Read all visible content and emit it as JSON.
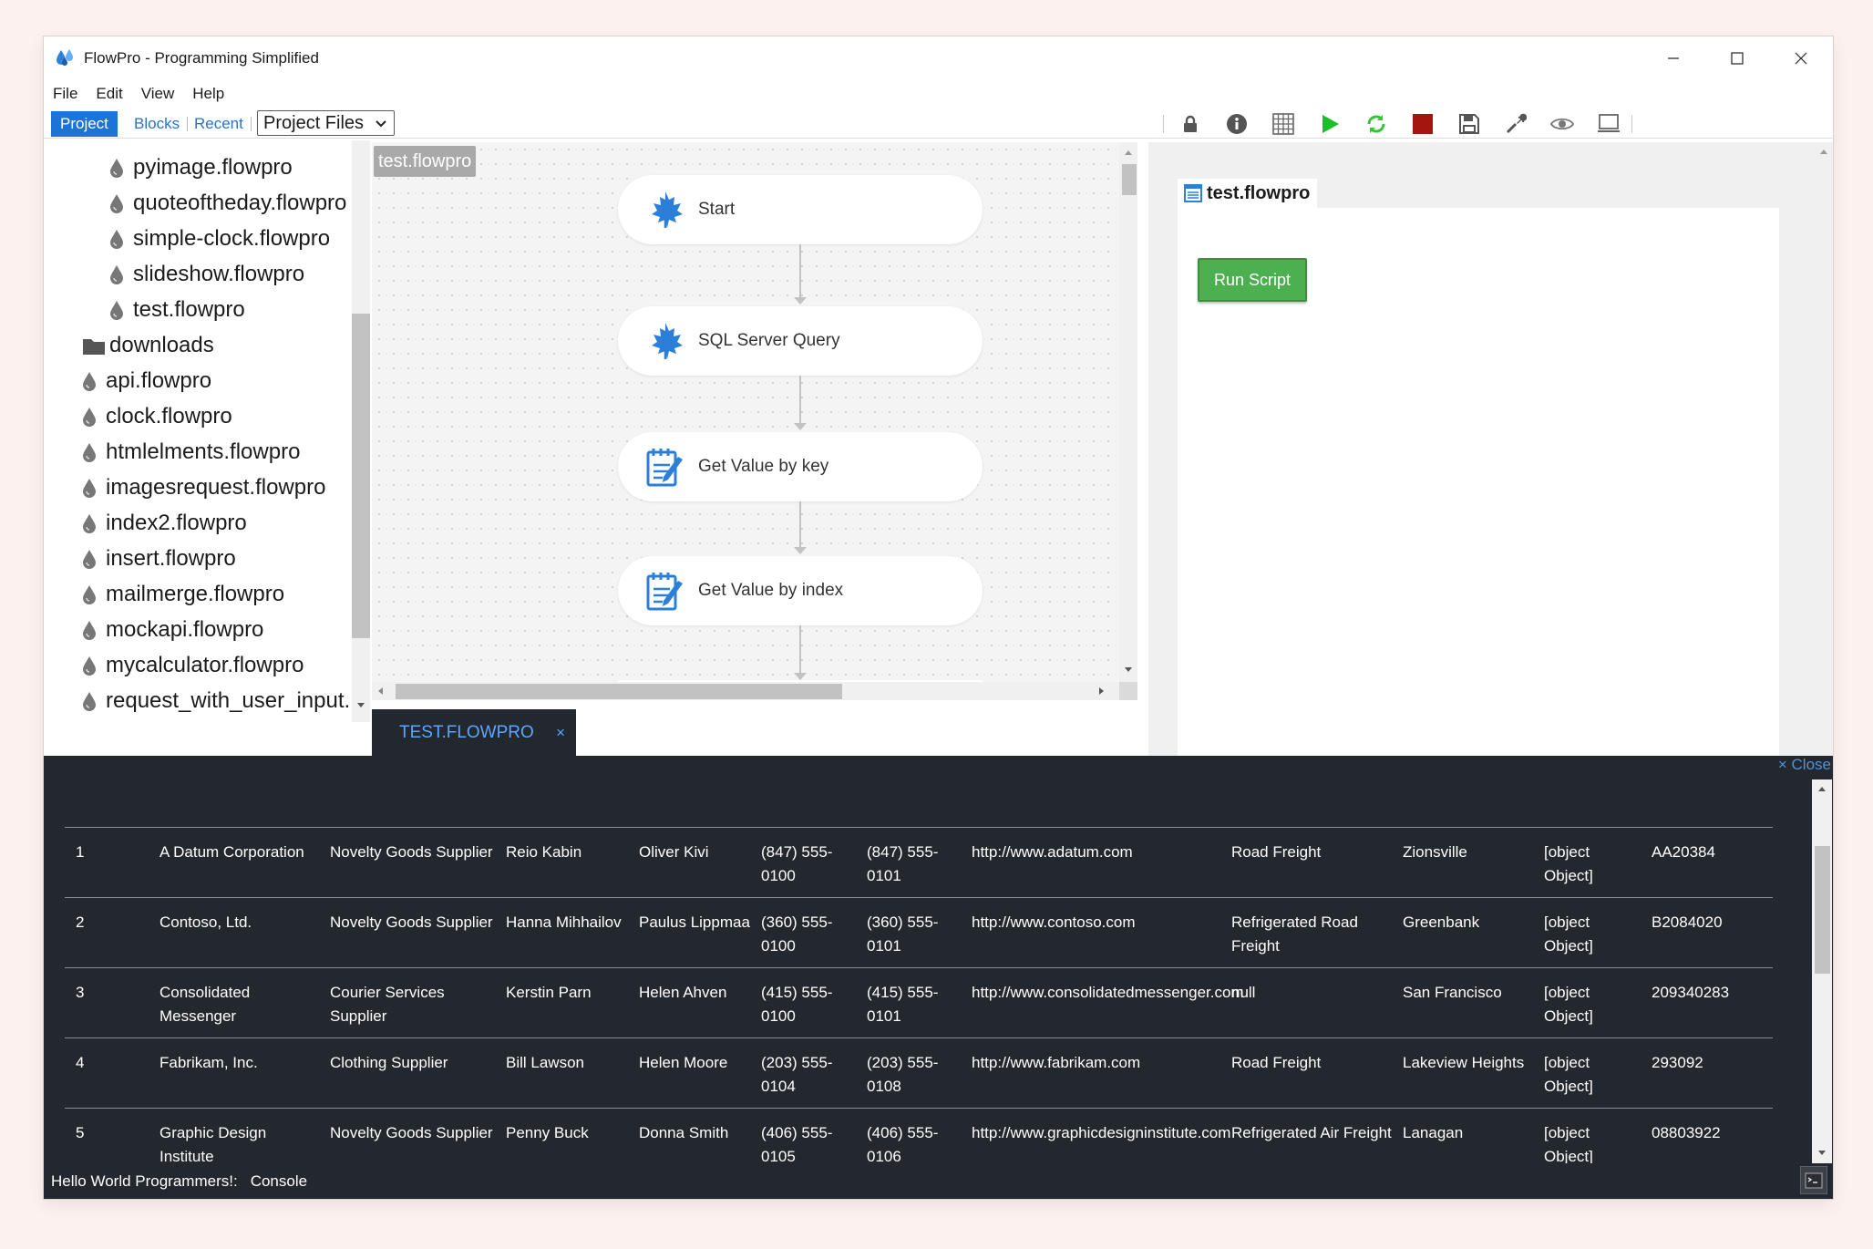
{
  "window": {
    "title": "FlowPro - Programming Simplified"
  },
  "menu": [
    "File",
    "Edit",
    "View",
    "Help"
  ],
  "toolbar": {
    "tab_project": "Project",
    "tab_blocks": "Blocks",
    "tab_recent": "Recent",
    "project_select": "Project Files",
    "tools": [
      "lock-icon",
      "info-icon",
      "grid-icon",
      "run-icon",
      "refresh-icon",
      "stop-icon",
      "save-icon",
      "settings-icon",
      "preview-icon",
      "desktop-icon"
    ]
  },
  "file_tree": {
    "items": [
      {
        "label": "pyimage.flowpro",
        "type": "file",
        "indent": 2
      },
      {
        "label": "quoteoftheday.flowpro",
        "type": "file",
        "indent": 2
      },
      {
        "label": "simple-clock.flowpro",
        "type": "file",
        "indent": 2
      },
      {
        "label": "slideshow.flowpro",
        "type": "file",
        "indent": 2
      },
      {
        "label": "test.flowpro",
        "type": "file",
        "indent": 2
      },
      {
        "label": "downloads",
        "type": "folder",
        "indent": 1
      },
      {
        "label": "api.flowpro",
        "type": "file",
        "indent": 1
      },
      {
        "label": "clock.flowpro",
        "type": "file",
        "indent": 1
      },
      {
        "label": "htmlelments.flowpro",
        "type": "file",
        "indent": 1
      },
      {
        "label": "imagesrequest.flowpro",
        "type": "file",
        "indent": 1
      },
      {
        "label": "index2.flowpro",
        "type": "file",
        "indent": 1
      },
      {
        "label": "insert.flowpro",
        "type": "file",
        "indent": 1
      },
      {
        "label": "mailmerge.flowpro",
        "type": "file",
        "indent": 1
      },
      {
        "label": "mockapi.flowpro",
        "type": "file",
        "indent": 1
      },
      {
        "label": "mycalculator.flowpro",
        "type": "file",
        "indent": 1
      },
      {
        "label": "request_with_user_input.",
        "type": "file",
        "indent": 1
      }
    ]
  },
  "canvas": {
    "tag": "test.flowpro",
    "nodes": [
      {
        "label": "Start",
        "icon": "maple-leaf-icon"
      },
      {
        "label": "SQL Server Query",
        "icon": "maple-leaf-icon"
      },
      {
        "label": "Get Value by key",
        "icon": "notepad-icon"
      },
      {
        "label": "Get Value by index",
        "icon": "notepad-icon"
      }
    ]
  },
  "doc_tab": {
    "label": "TEST.FLOWPRO",
    "close": "×"
  },
  "preview": {
    "tab": "test.flowpro",
    "run_button": "Run Script"
  },
  "console": {
    "close": "× Close",
    "rows": [
      [
        "1",
        "A Datum Corporation",
        "Novelty Goods Supplier",
        "Reio Kabin",
        "Oliver Kivi",
        "(847) 555-0100",
        "(847) 555-0101",
        "http://www.adatum.com",
        "Road Freight",
        "Zionsville",
        "[object Object]",
        "AA20384"
      ],
      [
        "2",
        "Contoso, Ltd.",
        "Novelty Goods Supplier",
        "Hanna Mihhailov",
        "Paulus Lippmaa",
        "(360) 555-0100",
        "(360) 555-0101",
        "http://www.contoso.com",
        "Refrigerated Road Freight",
        "Greenbank",
        "[object Object]",
        "B2084020"
      ],
      [
        "3",
        "Consolidated Messenger",
        "Courier Services Supplier",
        "Kerstin Parn",
        "Helen Ahven",
        "(415) 555-0100",
        "(415) 555-0101",
        "http://www.consolidatedmessenger.com",
        "null",
        "San Francisco",
        "[object Object]",
        "209340283"
      ],
      [
        "4",
        "Fabrikam, Inc.",
        "Clothing Supplier",
        "Bill Lawson",
        "Helen Moore",
        "(203) 555-0104",
        "(203) 555-0108",
        "http://www.fabrikam.com",
        "Road Freight",
        "Lakeview Heights",
        "[object Object]",
        "293092"
      ],
      [
        "5",
        "Graphic Design Institute",
        "Novelty Goods Supplier",
        "Penny Buck",
        "Donna Smith",
        "(406) 555-0105",
        "(406) 555-0106",
        "http://www.graphicdesigninstitute.com",
        "Refrigerated Air Freight",
        "Lanagan",
        "[object Object]",
        "08803922"
      ]
    ]
  },
  "status": {
    "text": "Hello World Programmers!:",
    "console_label": "Console"
  }
}
